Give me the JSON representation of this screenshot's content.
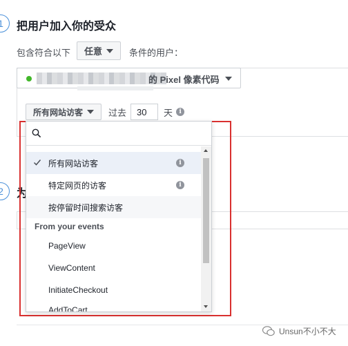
{
  "colors": {
    "accent": "#4a90d9",
    "highlight": "#d9302f",
    "pixel_status": "#42b72a"
  },
  "section1": {
    "step": "1",
    "title": "把用户加入你的受众"
  },
  "rule": {
    "include_label": "包含符合以下",
    "match_value": "任意",
    "condition_label": "条件的用户："
  },
  "pixel": {
    "name": "的 Pixel 像素代码"
  },
  "filter": {
    "visitors_value": "所有网站访客",
    "past_label": "过去",
    "days_value": "30",
    "days_label": "天"
  },
  "section2": {
    "step": "2",
    "title": "为"
  },
  "dropdown": {
    "search_icon": "search-icon",
    "options": [
      {
        "label": "所有网站访客",
        "checked": true
      },
      {
        "label": "特定网页的访客",
        "checked": false
      },
      {
        "label": "按停留时间搜索访客",
        "checked": false
      }
    ],
    "events_header": "From your events",
    "events": [
      "PageView",
      "ViewContent",
      "InitiateCheckout",
      "AddToCart"
    ]
  },
  "watermark": {
    "text": "Unsun不小不大"
  }
}
